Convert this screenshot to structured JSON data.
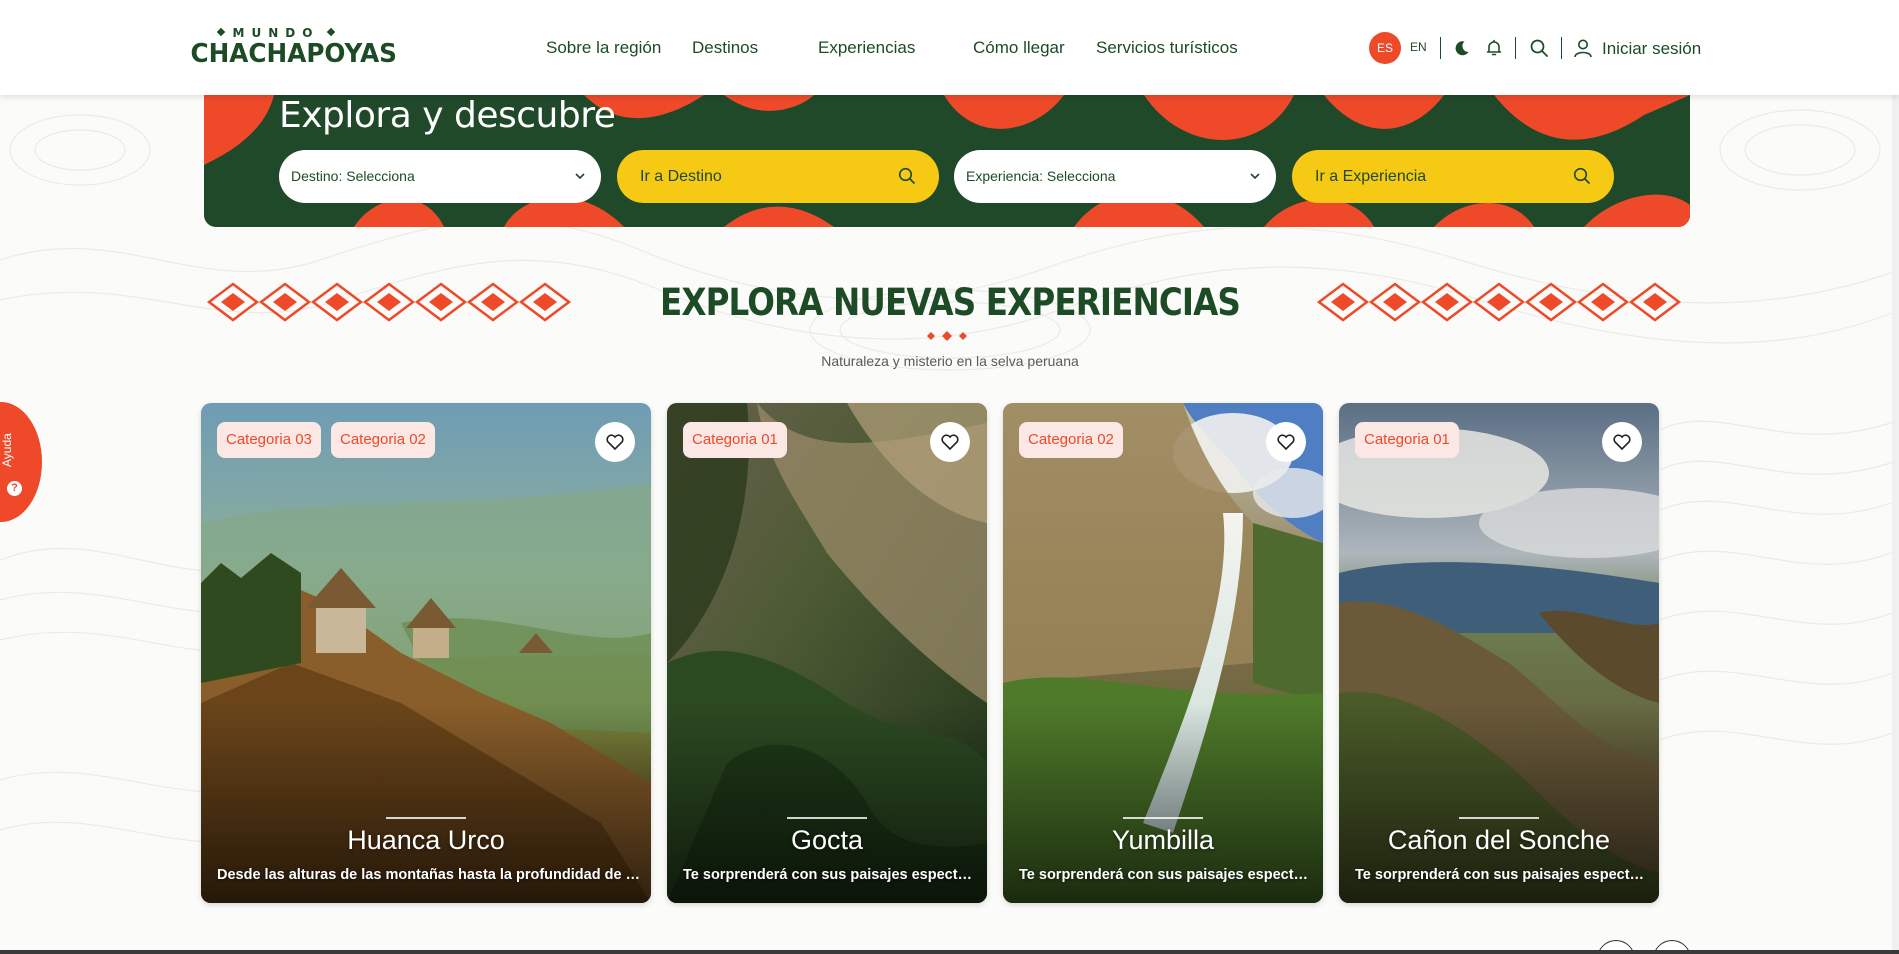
{
  "brand": {
    "top": "MUNDO",
    "main": "CHACHAPOYAS"
  },
  "nav": [
    "Sobre la región",
    "Destinos",
    "Experiencias",
    "Cómo llegar",
    "Servicios turísticos"
  ],
  "lang": {
    "es": "ES",
    "en": "EN"
  },
  "login": "Iniciar sesión",
  "banner": {
    "title": "Explora y descubre",
    "destino_select": "Destino: Selecciona",
    "destino_go": "Ir a Destino",
    "experiencia_select": "Experiencia: Selecciona",
    "experiencia_go": "Ir a Experiencia"
  },
  "section": {
    "title": "EXPLORA NUEVAS EXPERIENCIAS",
    "subtitle": "Naturaleza y misterio en la selva peruana"
  },
  "cards": [
    {
      "title": "Huanca Urco",
      "tags": [
        "Categoria 03",
        "Categoria 02"
      ],
      "desc": "Desde las alturas de las montañas hasta la profundidad de la ..."
    },
    {
      "title": "Gocta",
      "tags": [
        "Categoria 01"
      ],
      "desc": "Te sorprenderá con sus paisajes espectac..."
    },
    {
      "title": "Yumbilla",
      "tags": [
        "Categoria 02"
      ],
      "desc": "Te sorprenderá con sus paisajes espectac..."
    },
    {
      "title": "Cañon del Sonche",
      "tags": [
        "Categoria 01"
      ],
      "desc": "Te sorprenderá con sus paisajes espectac..."
    }
  ],
  "help": "Ayuda",
  "colors": {
    "brand_green": "#1d4b25",
    "accent_orange": "#ee4a2a",
    "accent_yellow": "#f6c915"
  }
}
